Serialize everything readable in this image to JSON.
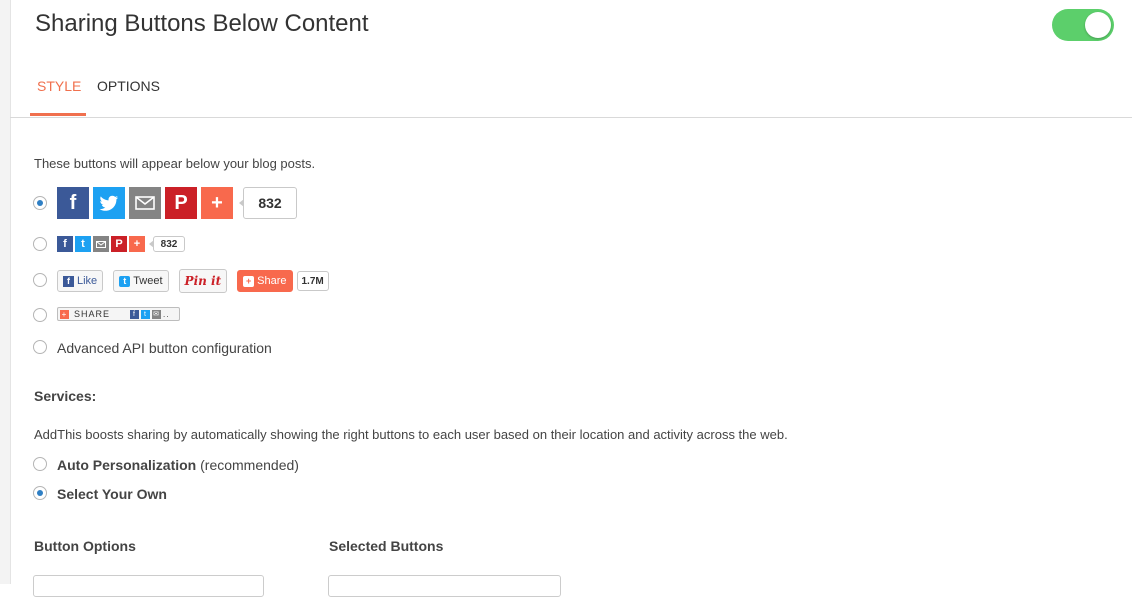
{
  "header": {
    "title": "Sharing Buttons Below Content",
    "toggle_on": true,
    "toggle_color": "#5ccf6b"
  },
  "tabs": [
    {
      "label": "STYLE",
      "active": true
    },
    {
      "label": "OPTIONS",
      "active": false
    }
  ],
  "accent_color": "#f0704e",
  "intro": "These buttons will appear below your blog posts.",
  "styles": {
    "large_count": "832",
    "small_count": "832",
    "native": {
      "like": "Like",
      "tweet": "Tweet",
      "pin": "Pin it",
      "share": "Share",
      "count": "1.7M"
    },
    "compact_label": "SHARE",
    "advanced_label": "Advanced API button configuration",
    "selected_index": 0
  },
  "services": {
    "title": "Services:",
    "description": "AddThis boosts sharing by automatically showing the right buttons to each user based on their location and activity across the web.",
    "auto_label": "Auto Personalization",
    "auto_note": "(recommended)",
    "select_label": "Select Your Own",
    "selected": "select"
  },
  "columns": {
    "button_options": "Button Options",
    "selected_buttons": "Selected Buttons"
  },
  "icons": [
    "facebook-icon",
    "twitter-icon",
    "email-icon",
    "pinterest-icon",
    "addthis-plus-icon"
  ]
}
